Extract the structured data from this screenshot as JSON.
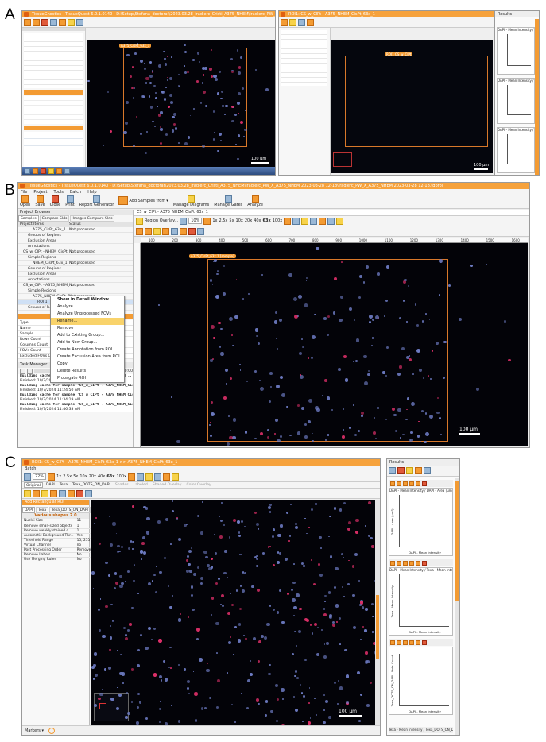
{
  "labels": {
    "a": "A",
    "b": "B",
    "c": "C"
  },
  "panelA": {
    "title_left": "TissueGnostics - TissueQuest 6.0.1.0140 - D:\\Setup\\Stefana_doctorat\\2023.03.28_iradierc_Cristi_A375_NHEM\\iradierc_PW_X_A375_NHEM 2023-03-28 12-18\\iradierc_PW_X_A375_NHEM 2023-03-28 12-18.tqproj",
    "title_right": "ROI1: CS_w_CIPt - A375_NHEM_CisPt_63x_1",
    "results": "Results",
    "plot_titles": [
      "DAPI - Mean Intensity / DAPI - Area (µm²)",
      "DAPI - Mean Intensity / Texas - Mean Intens...",
      "DAPI - Mean Intensity / Texa_DOTS_ON_D..."
    ],
    "scale_left": "100 µm",
    "scale_right": "100 µm",
    "roi_tag": "A375_CisPt_63x_1",
    "roi_tag_right": "ROI1 CS_w_CIPt"
  },
  "panelB": {
    "title": "TissueGnostics - TissueQuest 6.0.1.0140 - D:\\Setup\\Stefana_doctorat\\2023.03.28_iradierc_Cristi_A375_NHEM\\iradierc_PW_X_A375_NHEM 2023-03-28 12-18\\iradierc_PW_X_A375_NHEM 2023-03-28 12-18.tqproj",
    "menu": [
      "File",
      "Project",
      "Tools",
      "Batch",
      "Help"
    ],
    "toolbar": [
      "Open",
      "Save",
      "Close",
      "Print",
      "Report Generator",
      "Add Samples from",
      "Manage Diagrams",
      "Manage Gates",
      "Analyze"
    ],
    "project_browser": "Project Browser",
    "tabs": [
      "Samples",
      "Compare Slds",
      "Images Compare Slds"
    ],
    "tree_header": [
      "Project Items",
      "Status"
    ],
    "tree": [
      {
        "label": "A375_CisPt_63x_1",
        "status": "Not processed",
        "indent": 16
      },
      {
        "label": "Groups of Regions",
        "status": "",
        "indent": 10
      },
      {
        "label": "Exclusion Areas",
        "status": "",
        "indent": 10
      },
      {
        "label": "Annotations",
        "status": "",
        "indent": 10
      },
      {
        "label": "CS_w_CIPt - NHEM_CisPt_63...",
        "status": "Not processed",
        "indent": 4
      },
      {
        "label": "Simple Regions",
        "status": "",
        "indent": 10
      },
      {
        "label": "NHEM_CisPt_63x_1",
        "status": "Not processed",
        "indent": 16
      },
      {
        "label": "Groups of Regions",
        "status": "",
        "indent": 10
      },
      {
        "label": "Exclusion Areas",
        "status": "",
        "indent": 10
      },
      {
        "label": "Annotations",
        "status": "",
        "indent": 10
      },
      {
        "label": "CS_w_CIPt - A375_NHEM_Ci...",
        "status": "Not processed",
        "indent": 4
      },
      {
        "label": "Simple Regions",
        "status": "",
        "indent": 10
      },
      {
        "label": "A375_NHEM_CisPt_63...",
        "status": "Not processed",
        "indent": 16
      },
      {
        "label": "ROI 1",
        "status": "",
        "indent": 22
      },
      {
        "label": "Groups of R...",
        "status": "",
        "indent": 10
      }
    ],
    "context_menu": [
      "Show in Detail Window",
      "Analyze",
      "Analyze Unprocessed FOVs",
      "Rename...",
      "Remove",
      "Add to Existing Group...",
      "Add to New Group...",
      "Create Annotation from ROI",
      "Create Exclusion Area from ROI",
      "Copy",
      "Delete Results",
      "Propagate ROI"
    ],
    "context_selected": "Rename...",
    "props": [
      [
        "Type",
        ""
      ],
      [
        "Name",
        ""
      ],
      [
        "Sample",
        "A375_NHEM_CisPt..."
      ],
      [
        "Rows Count",
        ""
      ],
      [
        "Columns Count",
        ""
      ],
      [
        "FOVs Count",
        ""
      ],
      [
        "Excluded FOVs C...",
        ""
      ]
    ],
    "task_manager": "Task Manager",
    "task_time": "00:00:00",
    "log": [
      {
        "bold": "Building cache for sample 'CS_w_CIPt - A375_NHEM_...",
        "time": "Finished: 10/7/2024 11:21:00 AM"
      },
      {
        "bold": "Building cache for sample 'CS_w_CIPt - A375_NHEM_CisPt_...",
        "time": "Finished: 10/7/2024 11:24:50 AM"
      },
      {
        "bold": "Building cache for sample 'CS_w_CIPt - A375_NHEM_CisPt_63x_1'",
        "time": "Finished: 10/7/2024 11:34:19 AM"
      },
      {
        "bold": "Building cache for sample 'CS_w_CIPt - A375_NHEM_CisPt_63x_1'",
        "time": "Finished: 10/7/2024 11:46:33 AM"
      }
    ],
    "image_tab": "CS_w_CIPt - A375_NHEM_CisPt_63x_1",
    "region_overlay": "Region Overlay...",
    "zoom": "10%",
    "zooms": [
      "1x",
      "2.5x",
      "5x",
      "10x",
      "20x",
      "40x",
      "63x",
      "100x"
    ],
    "ruler": [
      "100",
      "200",
      "300",
      "400",
      "500",
      "600",
      "700",
      "800",
      "900",
      "1000",
      "1100",
      "1200",
      "1300",
      "1400",
      "1500",
      "1600"
    ],
    "roi_tag": "A375_CisPt_63x 1 [sample]",
    "scale": "100 µm"
  },
  "panelC": {
    "title": "ROI1: CS_w_CIPt - A375_NHEM_CisPt_63x_1 >> A375_NHEM_CisPt_63x_1",
    "menu_item": "Batch",
    "zoom": "22%",
    "zooms": [
      "1x",
      "2.5x",
      "5x",
      "10x",
      "20x",
      "40x",
      "63x",
      "100x"
    ],
    "channel_tabs": [
      "Original",
      "DAPI",
      "Texa",
      "Texa_DOTS_ON_DAPI",
      "Shades",
      "Labeled",
      "Shaded Overlay",
      "Color Overlay"
    ],
    "add_rect": "Add Rectangular ROI",
    "sub_tabs": [
      "DAPI",
      "Texa",
      "Texa_DOTS_ON_DAPI"
    ],
    "method": "Various shapes 2.0",
    "props": [
      [
        "Nuclei Size",
        "11"
      ],
      [
        "Remove small-sized objects",
        "1"
      ],
      [
        "Remove weakly stained o...",
        "1"
      ],
      [
        "Automatic Background Thr...",
        "Yes"
      ],
      [
        "Threshold Range",
        "15, 255"
      ],
      [
        "Virtual Channel",
        "no"
      ],
      [
        "Post Processing Order",
        "Remove, Merge"
      ],
      [
        "Remove Labels",
        "No"
      ],
      [
        "Use Merging Rules",
        "No"
      ]
    ],
    "markers": "Markers",
    "scale": "100 µm",
    "results": "Results",
    "plots": [
      {
        "title": "DAPI - Mean Intensity / DAPI - Area (µm²)",
        "ylabel": "DAPI - Area (µm²)",
        "xlabel": "DAPI - Mean Intensity"
      },
      {
        "title": "DAPI - Mean Intensity / Texa - Mean Intensi...",
        "ylabel": "Texa - Mean Intensity",
        "xlabel": "DAPI - Mean Intensity"
      },
      {
        "title": "",
        "ylabel": "Texa_DOTS_ON_DAPI - Dots Count",
        "xlabel": "DAPI - Mean Intensity"
      }
    ],
    "footer_plot": "Texa - Mean Intensity / Texa_DOTS_ON_D..."
  }
}
